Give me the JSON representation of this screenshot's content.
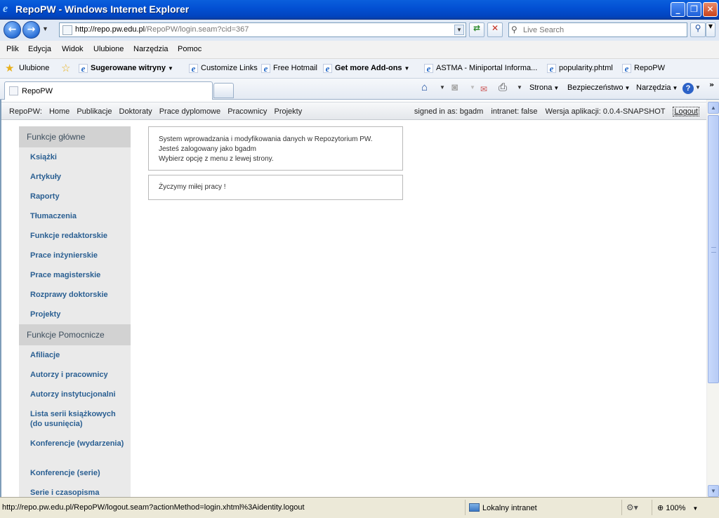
{
  "window": {
    "title": "RepoPW - Windows Internet Explorer",
    "icons": {
      "app": "ie-icon",
      "minimize": "minimize-icon",
      "maximize": "maximize-icon",
      "close": "close-icon"
    }
  },
  "address": {
    "url_host": "http://repo.pw.edu.pl",
    "url_path": "/RepoPW/login.seam?cid=367",
    "search_placeholder": "Live Search"
  },
  "menu": [
    "Plik",
    "Edycja",
    "Widok",
    "Ulubione",
    "Narzędzia",
    "Pomoc"
  ],
  "favorites": {
    "label": "Ulubione",
    "items": [
      {
        "label": "Sugerowane witryny",
        "bold": true,
        "dropdown": true
      },
      {
        "label": "Customize Links"
      },
      {
        "label": "Free Hotmail"
      },
      {
        "label": "Get more Add-ons",
        "bold": true,
        "dropdown": true
      },
      {
        "label": "ASTMA - Miniportal Informa..."
      },
      {
        "label": "popularity.phtml"
      },
      {
        "label": "RepoPW"
      }
    ]
  },
  "tab": {
    "label": "RepoPW"
  },
  "commands": {
    "page": "Strona",
    "safety": "Bezpieczeństwo",
    "tools": "Narzędzia",
    "more": "»"
  },
  "app": {
    "brand": "RepoPW:",
    "nav": [
      "Home",
      "Publikacje",
      "Doktoraty",
      "Prace dyplomowe",
      "Pracownicy",
      "Projekty"
    ],
    "signed_in": "signed in as: bgadm",
    "intranet": "intranet: false",
    "version": "Wersja aplikacji: 0.0.4-SNAPSHOT",
    "logout": "Logout"
  },
  "sidebar": {
    "groups": [
      {
        "header": "Funkcje główne",
        "items": [
          "Książki",
          "Artykuły",
          "Raporty",
          "Tłumaczenia",
          "Funkcje redaktorskie",
          "Prace inżynierskie",
          "Prace magisterskie",
          "Rozprawy doktorskie",
          "Projekty"
        ]
      },
      {
        "header": "Funkcje Pomocnicze",
        "items": [
          "Afiliacje",
          "Autorzy i pracownicy",
          "Autorzy instytucjonalni",
          "Lista serii książkowych (do usunięcia)",
          "Konferencje (wydarzenia)",
          "Konferencje (serie)",
          "Serie i czasopisma"
        ]
      }
    ]
  },
  "content": {
    "lines": [
      "System wprowadzania i modyfikowania danych w Repozytorium PW.",
      "Jesteś zalogowany jako bgadm",
      "Wybierz opcję z menu z lewej strony."
    ],
    "wish": "Życzymy miłej pracy !"
  },
  "status": {
    "text": "http://repo.pw.edu.pl/RepoPW/logout.seam?actionMethod=login.xhtml%3Aidentity.logout",
    "zone": "Lokalny intranet",
    "zoom": "100%"
  }
}
